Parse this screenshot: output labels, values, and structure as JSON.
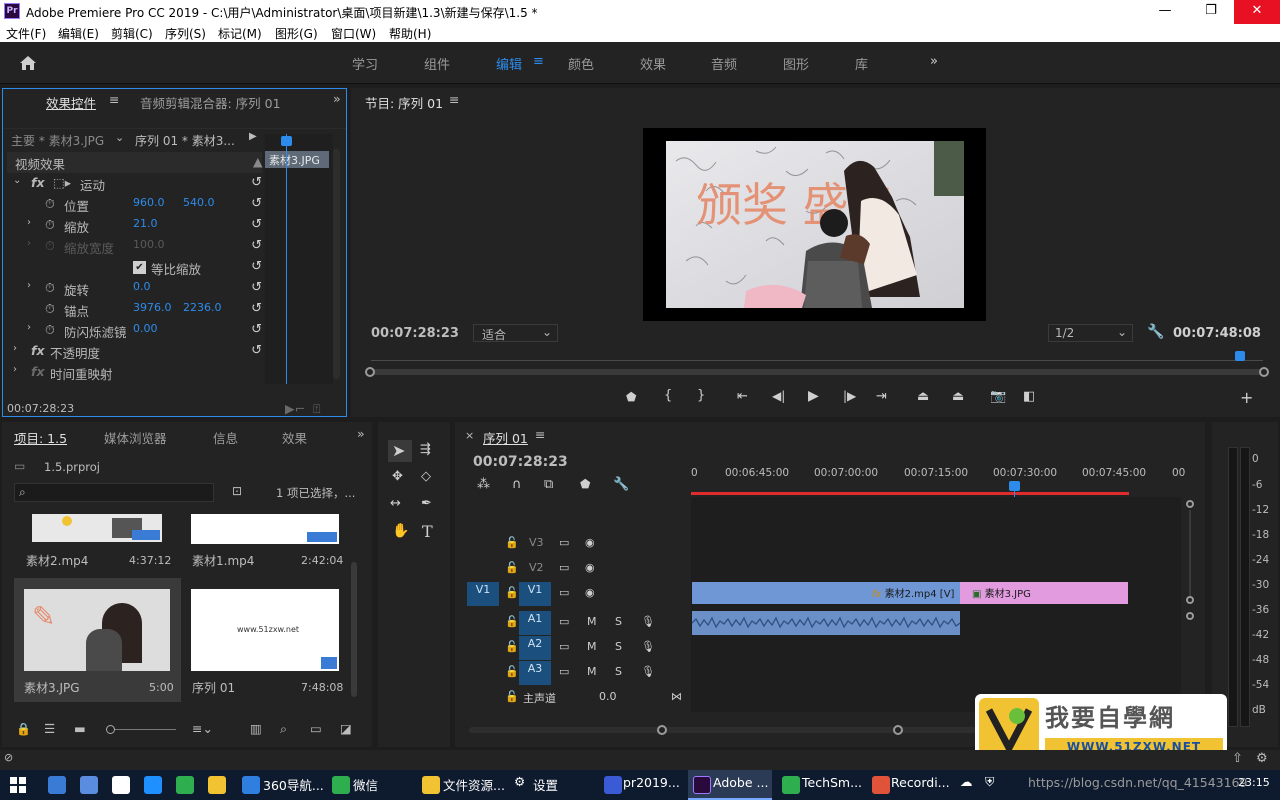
{
  "window": {
    "title": "Adobe Premiere Pro CC 2019 - C:\\用户\\Administrator\\桌面\\项目新建\\1.3\\新建与保存\\1.5 *",
    "logo": "Pr"
  },
  "menu": [
    "文件(F)",
    "编辑(E)",
    "剪辑(C)",
    "序列(S)",
    "标记(M)",
    "图形(G)",
    "窗口(W)",
    "帮助(H)"
  ],
  "workspaces": [
    "学习",
    "组件",
    "编辑",
    "颜色",
    "效果",
    "音频",
    "图形",
    "库"
  ],
  "active_workspace": "编辑",
  "effect_controls": {
    "tab1": "效果控件",
    "tab2": "音频剪辑混合器: 序列 01",
    "master": "主要 * 素材3.JPG",
    "sequence": "序列 01 * 素材3...",
    "clip_label": "素材3.JPG",
    "section": "视频效果",
    "motion": "运动",
    "position": {
      "label": "位置",
      "x": "960.0",
      "y": "540.0"
    },
    "scale": {
      "label": "缩放",
      "value": "21.0"
    },
    "scale_width": {
      "label": "缩放宽度",
      "value": "100.0"
    },
    "uniform": "等比缩放",
    "rotation": {
      "label": "旋转",
      "value": "0.0"
    },
    "anchor": {
      "label": "锚点",
      "x": "3976.0",
      "y": "2236.0"
    },
    "antiflicker": {
      "label": "防闪烁滤镜",
      "value": "0.00"
    },
    "opacity": "不透明度",
    "time_remap": "时间重映射",
    "timecode": "00:07:28:23"
  },
  "program": {
    "title": "节目: 序列 01",
    "timecode_left": "00:07:28:23",
    "fit": "适合",
    "resolution": "1/2",
    "timecode_right": "00:07:48:08",
    "image_text": "颁奖 盛典"
  },
  "project": {
    "tabs": [
      "项目: 1.5",
      "媒体浏览器",
      "信息",
      "效果"
    ],
    "file": "1.5.prproj",
    "selected": "1 项已选择，...",
    "items": [
      {
        "name": "素材2.mp4",
        "duration": "4:37:12"
      },
      {
        "name": "素材1.mp4",
        "duration": "2:42:04"
      },
      {
        "name": "素材3.JPG",
        "duration": "5:00"
      },
      {
        "name": "序列 01",
        "duration": "7:48:08",
        "thumb_text": "www.51zxw.net"
      }
    ]
  },
  "timeline": {
    "title": "序列 01",
    "timecode": "00:07:28:23",
    "ruler": [
      "0",
      "00:06:45:00",
      "00:07:00:00",
      "00:07:15:00",
      "00:07:30:00",
      "00:07:45:00",
      "00"
    ],
    "tracks": [
      {
        "name": "V3",
        "type": "video"
      },
      {
        "name": "V2",
        "type": "video"
      },
      {
        "name": "V1",
        "type": "video",
        "source": "V1"
      },
      {
        "name": "A1",
        "type": "audio"
      },
      {
        "name": "A2",
        "type": "audio"
      },
      {
        "name": "A3",
        "type": "audio"
      }
    ],
    "master": "主声道",
    "master_value": "0.0",
    "clip_video": "素材2.mp4 [V]",
    "clip_image": "素材3.JPG",
    "audio_meter": [
      "0",
      "-6",
      "-12",
      "-18",
      "-24",
      "-30",
      "-36",
      "-42",
      "-48",
      "-54",
      "dB"
    ]
  },
  "watermark": {
    "brand": "我要自學網",
    "url": "WWW.51ZXW.NET"
  },
  "taskbar": {
    "items": [
      "360导航...",
      "微信",
      "文件资源...",
      "设置",
      "pr2019...",
      "Adobe ...",
      "TechSm...",
      "Recordi..."
    ],
    "url_overlay": "https://blog.csdn.net/qq_41543169",
    "time": "23:15"
  },
  "colors": {
    "accent": "#2d8ceb",
    "video_clip": "#6f97d6",
    "image_clip": "#e19bde",
    "audio_clip": "#6b8fc7",
    "red_bar": "#e02c2c"
  }
}
